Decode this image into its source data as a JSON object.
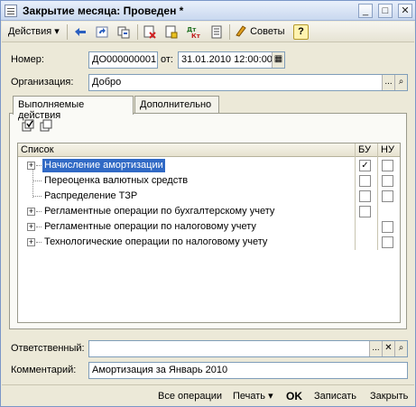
{
  "window": {
    "title": "Закрытие месяца: Проведен *",
    "controls": {
      "minimize": "_",
      "maximize": "□",
      "close": "✕"
    }
  },
  "toolbar": {
    "actions_label": "Действия",
    "actions_arrow": "▾",
    "tips_label": "Советы",
    "help_label": "?",
    "icons": [
      "arrow-left-icon",
      "refresh-icon",
      "copy-icon",
      "delete-doc-icon",
      "post-doc-icon",
      "dt-kt-icon",
      "report-icon",
      "tips-icon"
    ]
  },
  "form": {
    "number_label": "Номер:",
    "number_value": "ДО000000001",
    "date_label": "от:",
    "date_value": "31.01.2010 12:00:00",
    "org_label": "Организация:",
    "org_value": "Добро",
    "responsible_label": "Ответственный:",
    "responsible_value": "",
    "comment_label": "Комментарий:",
    "comment_value": "Амортизация за Январь 2010"
  },
  "tabs": [
    {
      "label": "Выполняемые действия",
      "active": true
    },
    {
      "label": "Дополнительно",
      "active": false
    }
  ],
  "table": {
    "headers": {
      "list": "Список",
      "bu": "БУ",
      "nu": "НУ"
    },
    "rows": [
      {
        "label": "Начисление амортизации",
        "expandable": true,
        "selected": true,
        "bu": "checked",
        "nu": "empty"
      },
      {
        "label": "Переоценка валютных средств",
        "expandable": false,
        "selected": false,
        "bu": "empty",
        "nu": "empty"
      },
      {
        "label": "Распределение ТЗР",
        "expandable": false,
        "selected": false,
        "bu": "empty",
        "nu": "empty"
      },
      {
        "label": "Регламентные операции по бухгалтерскому учету",
        "expandable": true,
        "selected": false,
        "bu": "empty",
        "nu": "none"
      },
      {
        "label": "Регламентные операции по налоговому учету",
        "expandable": true,
        "selected": false,
        "bu": "none",
        "nu": "empty"
      },
      {
        "label": "Технологические операции по налоговому учету",
        "expandable": true,
        "selected": false,
        "bu": "none",
        "nu": "empty"
      }
    ]
  },
  "buttons": {
    "all_operations": "Все операции",
    "print": "Печать",
    "print_arrow": "▾",
    "ok": "OK",
    "save": "Записать",
    "close": "Закрыть"
  },
  "colors": {
    "selection": "#316ac5",
    "window_bg": "#ece9d8",
    "field_border": "#7f9db9"
  }
}
